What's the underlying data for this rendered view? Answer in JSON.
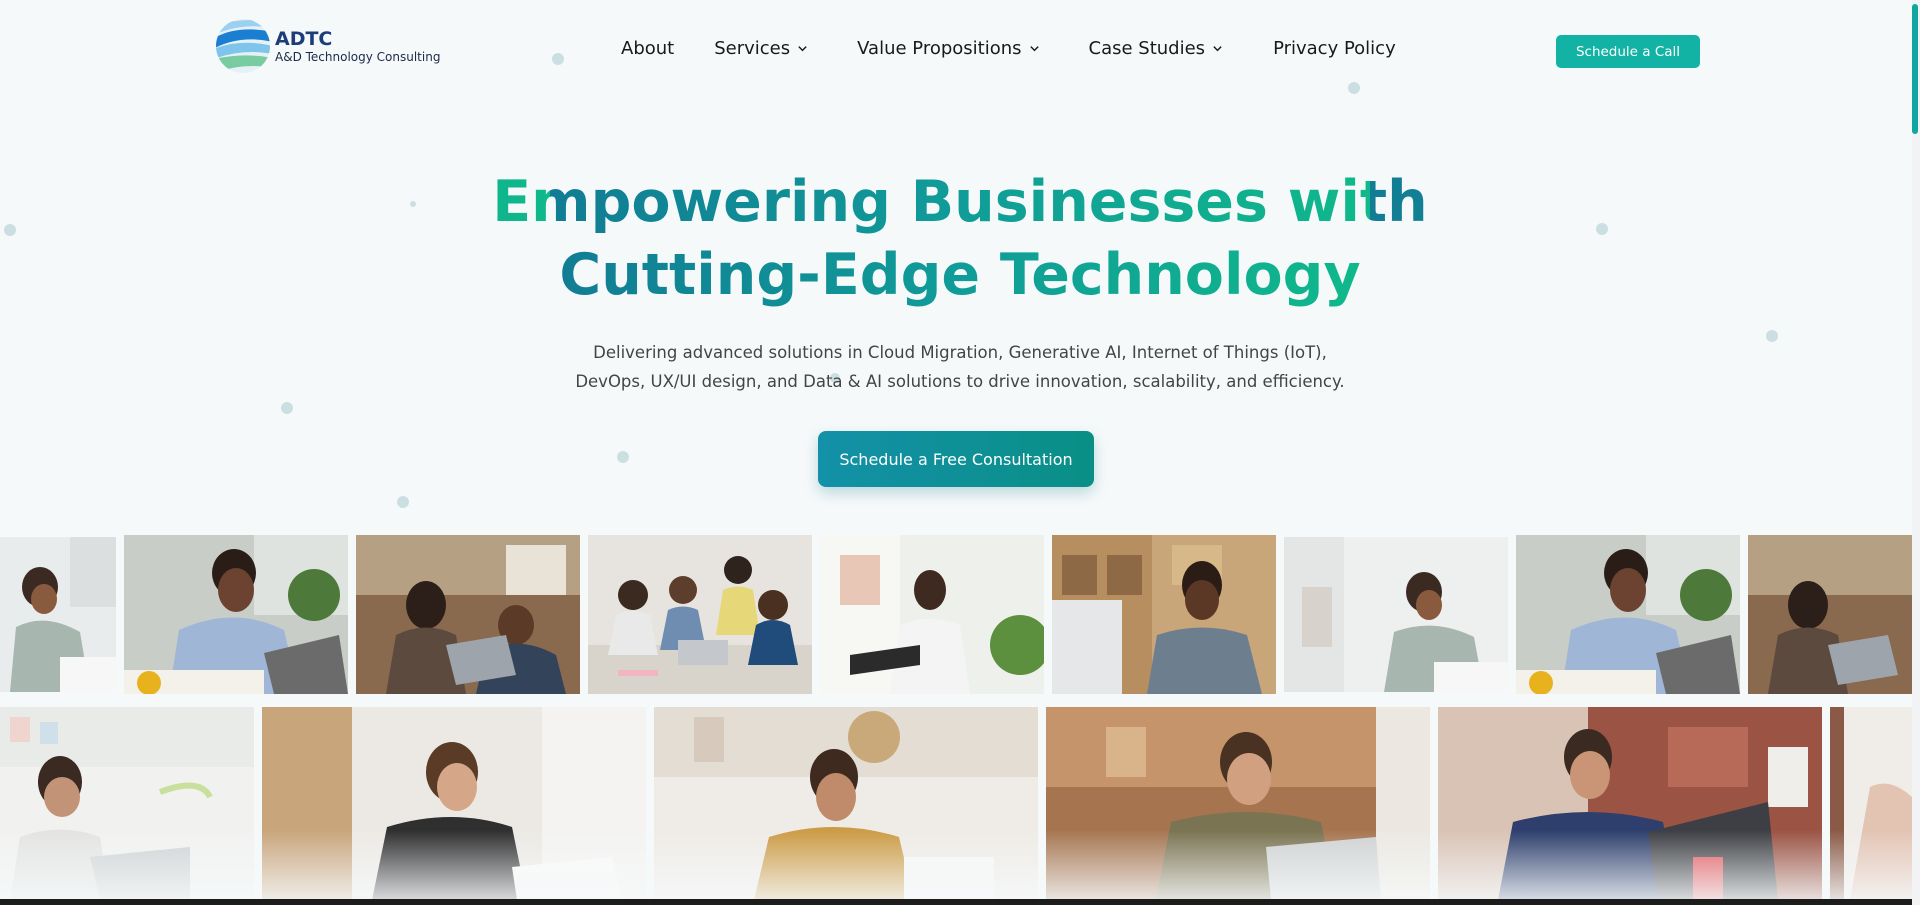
{
  "brand": {
    "name": "ADTC",
    "tagline": "A&D Technology Consulting"
  },
  "nav": {
    "about": "About",
    "services": "Services",
    "value_propositions": "Value Propositions",
    "case_studies": "Case Studies",
    "privacy_policy": "Privacy Policy"
  },
  "header": {
    "cta_label": "Schedule a Call"
  },
  "hero": {
    "title_line1": "Empowering Businesses with",
    "title_line2": "Cutting-Edge Technology",
    "subtitle_line1": "Delivering advanced solutions in Cloud Migration, Generative AI, Internet of Things (IoT),",
    "subtitle_line2": "DevOps, UX/UI design, and Data & AI solutions to drive innovation, scalability, and efficiency.",
    "cta_label": "Schedule a Free Consultation"
  },
  "colors": {
    "accent": "#12b3a5",
    "gradient_start": "#117c94",
    "gradient_end": "#0fb98a"
  },
  "icons": [
    "chevron-down-icon",
    "globe-logo-icon"
  ]
}
